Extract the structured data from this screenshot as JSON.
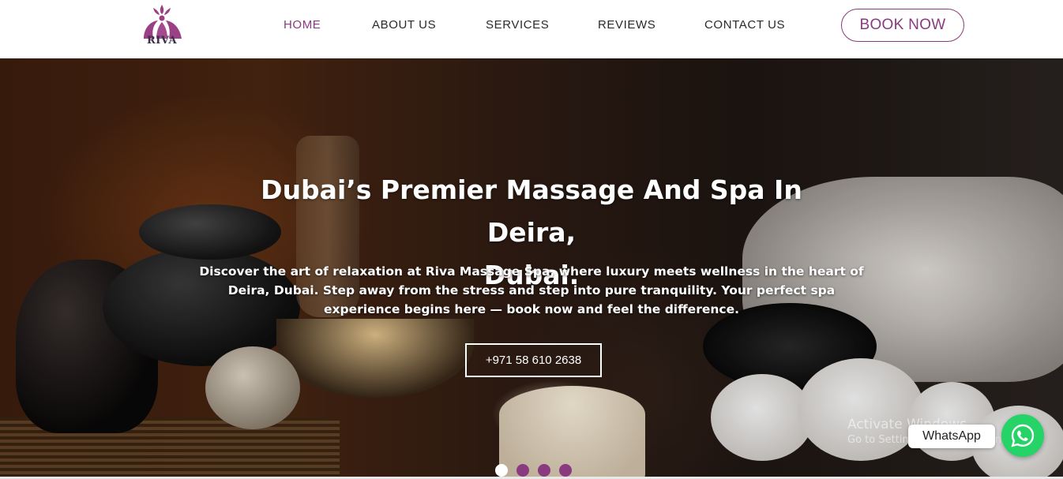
{
  "header": {
    "logo_text": "RIVA",
    "nav": [
      "HOME",
      "ABOUT US",
      "SERVICES",
      "REVIEWS",
      "CONTACT US"
    ],
    "active_nav": "HOME",
    "book_button": "BOOK NOW"
  },
  "hero": {
    "title_line1": "Dubai’s Premier Massage And Spa In Deira,",
    "title_line2": "Dubai.",
    "description": "Discover the art of relaxation at Riva Massage Spa, where luxury meets wellness in the heart of Deira, Dubai. Step away from the stress and step into pure tranquility. Your perfect spa experience begins here — book now and feel the difference.",
    "phone_button": "+971 58 610 2638",
    "slides": {
      "count": 4,
      "active_index": 0
    }
  },
  "overlay": {
    "watermark_line1": "Activate Windows",
    "watermark_line2": "Go to Settings to activate Windows.",
    "whatsapp_label": "WhatsApp"
  },
  "colors": {
    "brand": "#8a3a7e",
    "whatsapp": "#25d366"
  }
}
